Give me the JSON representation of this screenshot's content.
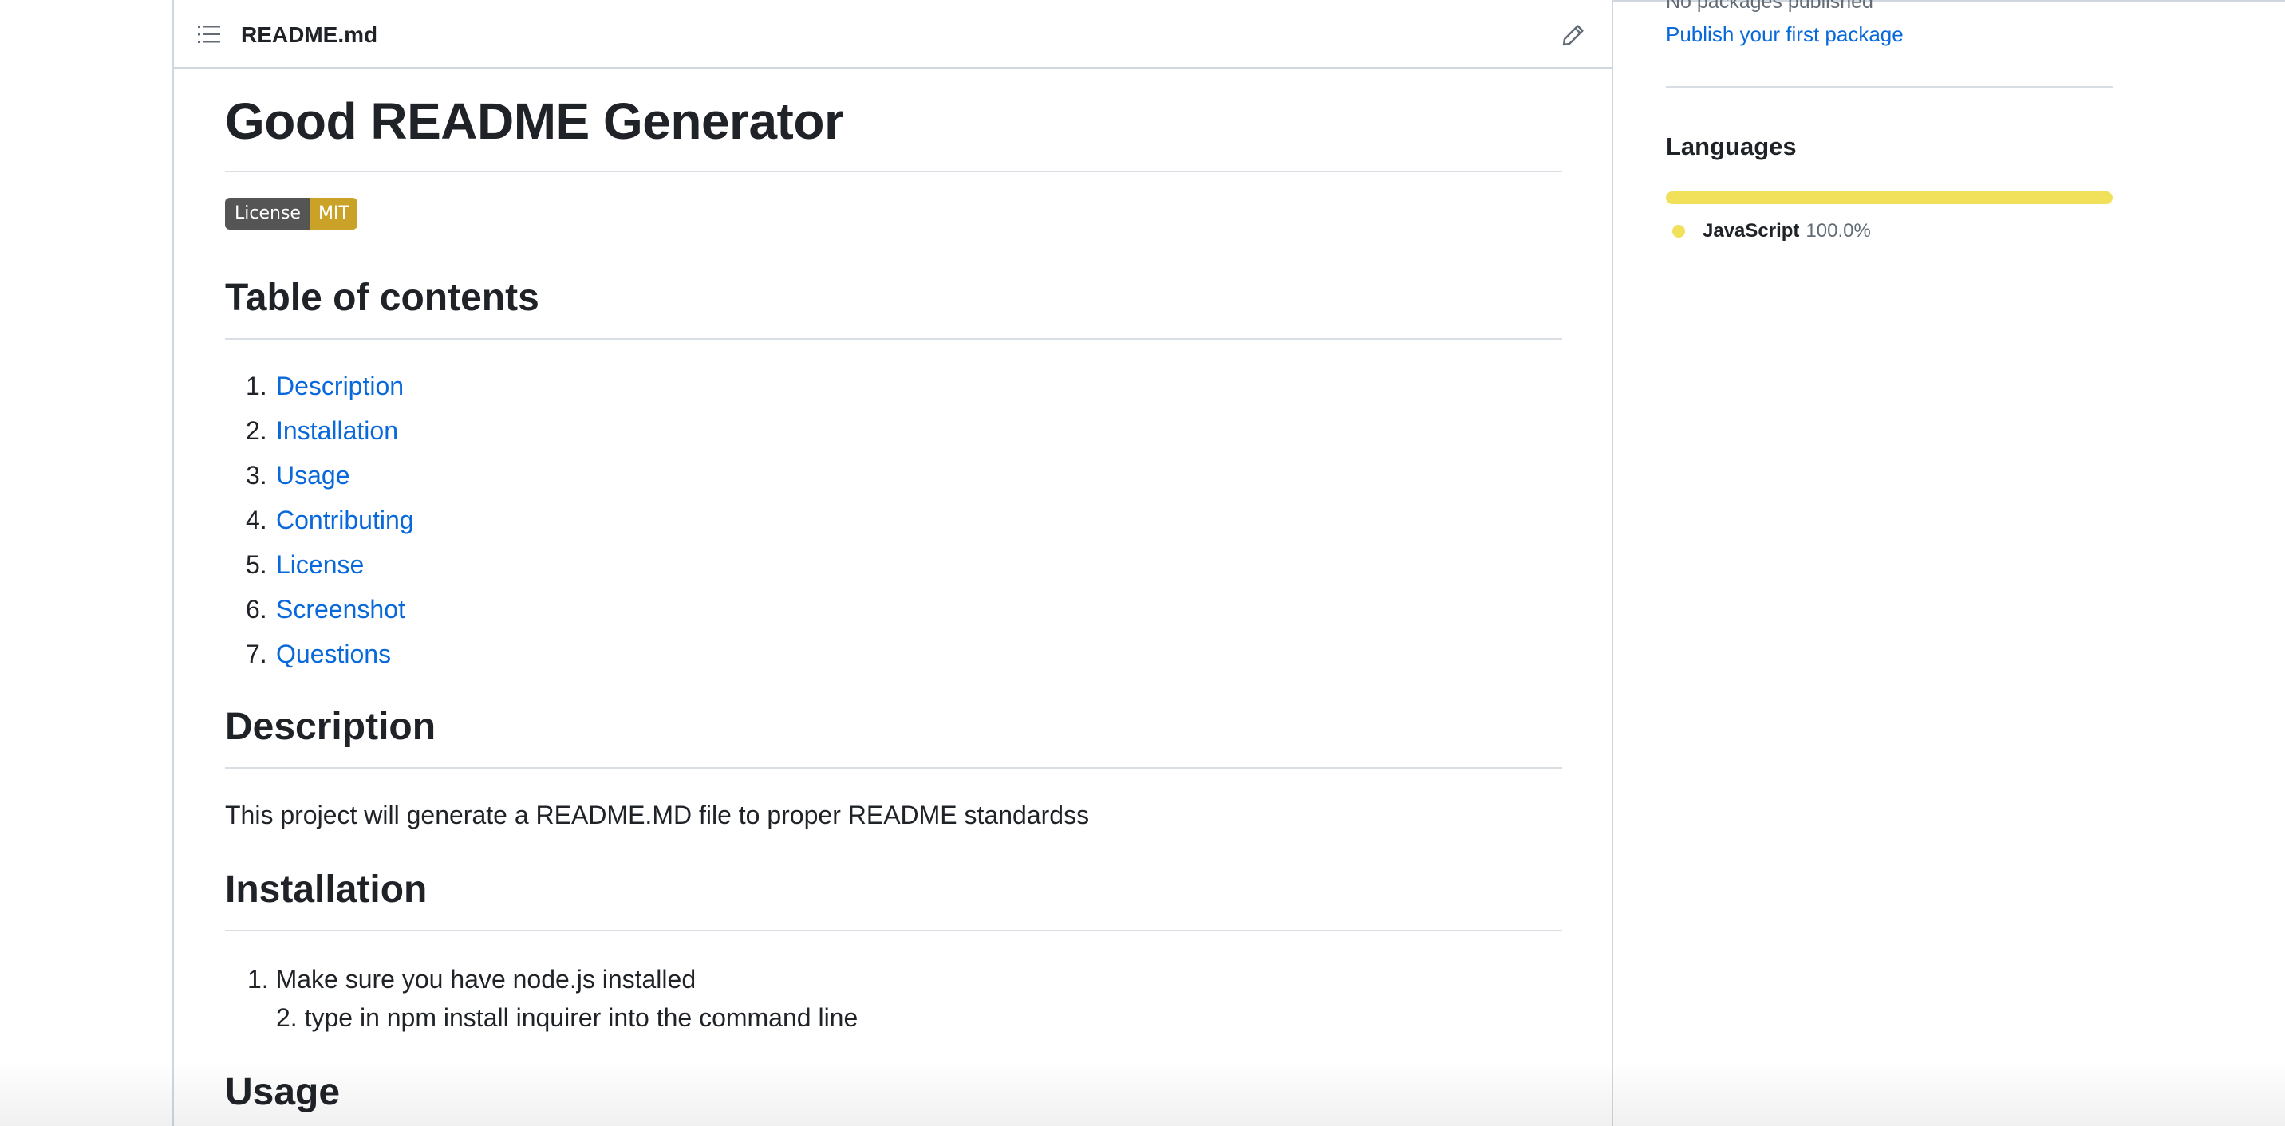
{
  "readme": {
    "filename": "README.md",
    "title": "Good README Generator",
    "badge": {
      "label": "License",
      "value": "MIT",
      "value_color": "#c9a227"
    },
    "toc": {
      "heading": "Table of contents",
      "items": [
        {
          "num": "1.",
          "label": "Description"
        },
        {
          "num": "2.",
          "label": "Installation"
        },
        {
          "num": "3.",
          "label": "Usage"
        },
        {
          "num": "4.",
          "label": "Contributing"
        },
        {
          "num": "5.",
          "label": "License"
        },
        {
          "num": "6.",
          "label": "Screenshot"
        },
        {
          "num": "7.",
          "label": "Questions"
        }
      ]
    },
    "description": {
      "heading": "Description",
      "text": "This project will generate a README.MD file to proper README standardss"
    },
    "installation": {
      "heading": "Installation",
      "items": [
        {
          "num": "1.",
          "text": "Make sure you have node.js installed"
        },
        {
          "num": "2.",
          "text": "type in npm install inquirer into the command line"
        }
      ]
    },
    "usage": {
      "heading": "Usage"
    }
  },
  "sidebar": {
    "packages_status": "No packages published",
    "publish_link": "Publish your first package",
    "languages": {
      "heading": "Languages",
      "items": [
        {
          "name": "JavaScript",
          "percent": "100.0%",
          "color": "#f1e05a"
        }
      ]
    }
  },
  "icons": {
    "toc": "list-icon",
    "edit": "pencil-icon"
  },
  "colors": {
    "link": "#0969da",
    "text": "#1f2328",
    "border": "#d0d7de"
  }
}
